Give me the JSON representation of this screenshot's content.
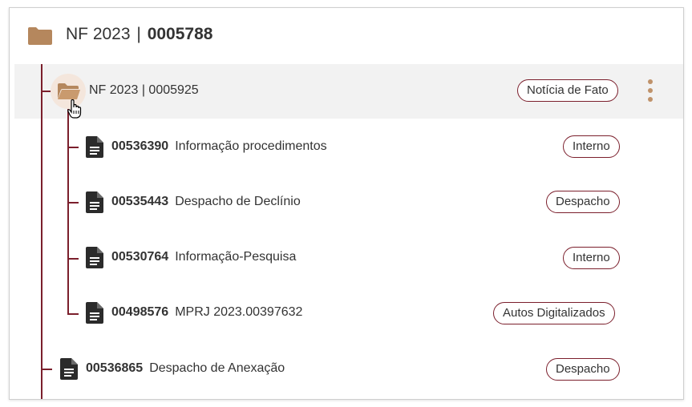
{
  "root": {
    "prefix": "NF 2023",
    "separator": "|",
    "number": "0005788"
  },
  "sub_folder": {
    "title": "NF 2023 | 0005925",
    "badge": "Notícia de Fato"
  },
  "children": [
    {
      "code": "00536390",
      "title": "Informação procedimentos",
      "badge": "Interno"
    },
    {
      "code": "00535443",
      "title": "Despacho de Declínio",
      "badge": "Despacho"
    },
    {
      "code": "00530764",
      "title": "Informação-Pesquisa",
      "badge": "Interno"
    },
    {
      "code": "00498576",
      "title": "MPRJ 2023.00397632",
      "badge": "Autos Digitalizados"
    }
  ],
  "sibling": {
    "code": "00536865",
    "title": "Despacho de Anexação",
    "badge": "Despacho"
  },
  "colors": {
    "tree_line": "#7b1f2c",
    "folder": "#b5875d",
    "badge_border": "#7b1f2c",
    "highlight": "#f2f2f2"
  },
  "icons": [
    "folder-icon",
    "folder-open-icon",
    "hand-cursor-icon",
    "document-icon",
    "more-vert-icon"
  ]
}
